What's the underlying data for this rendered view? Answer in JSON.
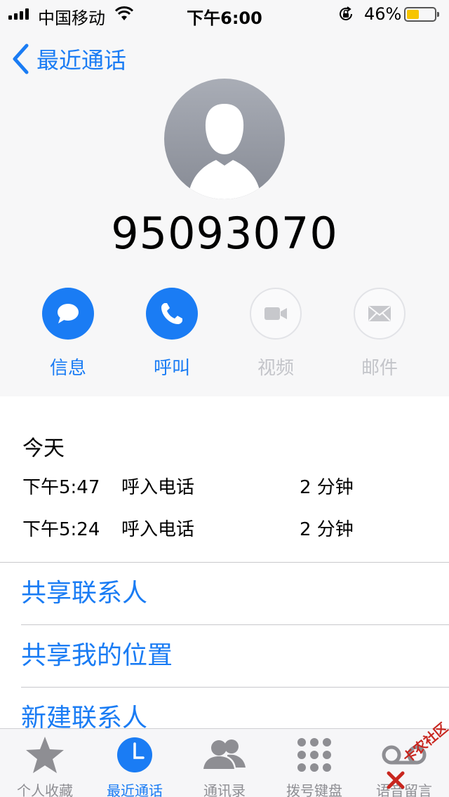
{
  "status_bar": {
    "carrier": "中国移动",
    "time": "下午6:00",
    "battery_percent": "46%",
    "battery_level": 0.46,
    "battery_color": "#f7c500",
    "icons": [
      "signal-icon",
      "wifi-icon",
      "orientation-lock-icon",
      "battery-icon"
    ]
  },
  "nav": {
    "back_label": "最近通话"
  },
  "contact": {
    "number": "95093070",
    "avatar_icon": "person-silhouette-icon"
  },
  "actions": [
    {
      "label": "信息",
      "icon": "message-icon",
      "enabled": true
    },
    {
      "label": "呼叫",
      "icon": "phone-icon",
      "enabled": true
    },
    {
      "label": "视频",
      "icon": "video-icon",
      "enabled": false
    },
    {
      "label": "邮件",
      "icon": "mail-icon",
      "enabled": false
    }
  ],
  "history": {
    "title": "今天",
    "calls": [
      {
        "time": "下午5:47",
        "type": "呼入电话",
        "duration": "2 分钟"
      },
      {
        "time": "下午5:24",
        "type": "呼入电话",
        "duration": "2 分钟"
      }
    ]
  },
  "options": [
    {
      "label": "共享联系人"
    },
    {
      "label": "共享我的位置"
    },
    {
      "label": "新建联系人"
    }
  ],
  "tab_bar": {
    "items": [
      {
        "label": "个人收藏",
        "icon": "star-icon",
        "selected": false
      },
      {
        "label": "最近通话",
        "icon": "clock-icon",
        "selected": true
      },
      {
        "label": "通讯录",
        "icon": "contacts-icon",
        "selected": false
      },
      {
        "label": "拨号键盘",
        "icon": "keypad-icon",
        "selected": false
      },
      {
        "label": "语音留言",
        "icon": "voicemail-icon",
        "selected": false
      }
    ]
  },
  "watermark": {
    "text": "卡农社区"
  },
  "colors": {
    "accent": "#1a7cf4",
    "disabled": "#c3c4c9",
    "avatar_gray": "#9a9ea7"
  }
}
